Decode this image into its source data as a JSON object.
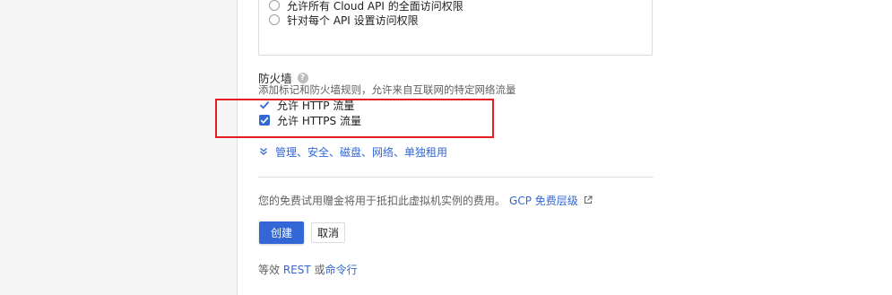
{
  "api_access": {
    "options": [
      {
        "label": "允许所有 Cloud API 的全面访问权限"
      },
      {
        "label": "针对每个 API 设置访问权限"
      }
    ]
  },
  "firewall": {
    "title": "防火墙",
    "help_icon": "help-icon",
    "description": "添加标记和防火墙规则，允许来自互联网的特定网络流量",
    "http_label": "允许 HTTP 流量",
    "https_label": "允许 HTTPS 流量",
    "http_checked": true,
    "https_checked": true
  },
  "more": {
    "label": "管理、安全、磁盘、网络、单独租用",
    "icon": "double-chevron-down-icon"
  },
  "trial": {
    "text": "您的免费试用赠金将用于抵扣此虚拟机实例的费用。",
    "link": "GCP 免费层级",
    "icon": "external-link-icon"
  },
  "actions": {
    "create_label": "创建",
    "cancel_label": "取消"
  },
  "equivalent": {
    "prefix": "等效",
    "rest": "REST",
    "or": "或",
    "cli": "命令行"
  },
  "colors": {
    "accent": "#3367d6",
    "highlight": "#e51c23"
  }
}
